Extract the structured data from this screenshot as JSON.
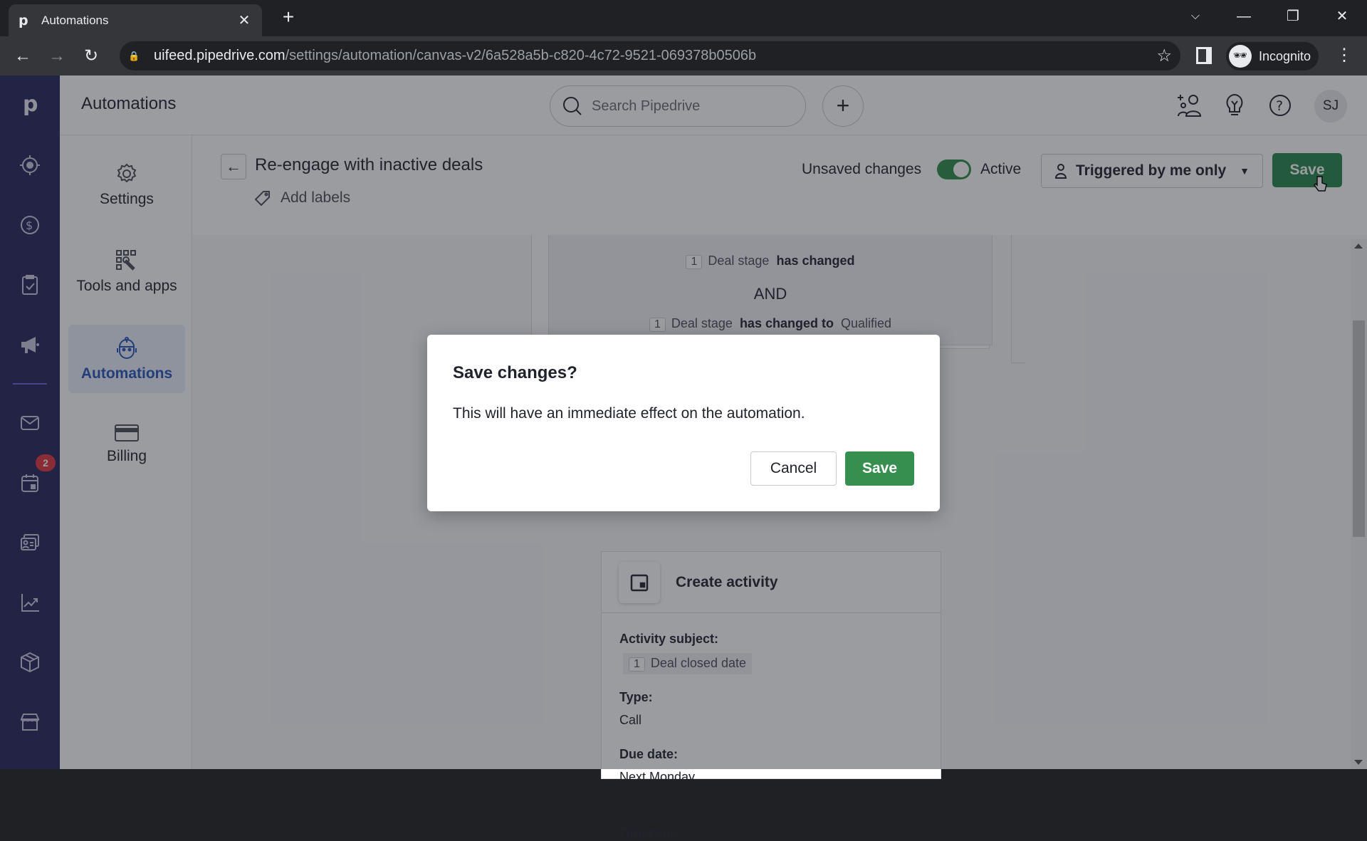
{
  "browser": {
    "tab_title": "Automations",
    "tab_favicon": "p",
    "url_host": "uifeed.pipedrive.com",
    "url_path": "/settings/automation/canvas-v2/6a528a5b-c820-4c72-9521-069378b0506b",
    "profile_label": "Incognito"
  },
  "app": {
    "title": "Automations",
    "search_placeholder": "Search Pipedrive",
    "avatar_initials": "SJ",
    "left_nav": {
      "icons": [
        "leads-target-icon",
        "deals-dollar-icon",
        "activities-clipboard-icon",
        "campaigns-megaphone-icon",
        "mail-icon",
        "calendar-icon",
        "contacts-card-icon",
        "insights-chart-icon",
        "products-box-icon",
        "marketplace-store-icon"
      ],
      "calendar_badge": "2"
    },
    "settings_nav": [
      {
        "label": "Settings",
        "icon": "gear-icon",
        "active": false
      },
      {
        "label": "Tools and apps",
        "icon": "tools-apps-icon",
        "active": false
      },
      {
        "label": "Automations",
        "icon": "robot-icon",
        "active": true
      },
      {
        "label": "Billing",
        "icon": "credit-card-icon",
        "active": false
      }
    ]
  },
  "editor": {
    "automation_name": "Re-engage with inactive deals",
    "add_labels": "Add labels",
    "unsaved_changes": "Unsaved changes",
    "active_label": "Active",
    "active": true,
    "trigger_scope": "Triggered by me only",
    "save_label": "Save",
    "trigger_card": {
      "cond1": {
        "chip": "1",
        "field": "Deal stage",
        "op": "has changed",
        "value": ""
      },
      "joiner": "AND",
      "cond2": {
        "chip": "1",
        "field": "Deal stage",
        "op": "has changed to",
        "value": "Qualified"
      }
    },
    "action_card": {
      "title": "Create activity",
      "fields": [
        {
          "label": "Activity subject:",
          "chip": "1",
          "value": "Deal closed date"
        },
        {
          "label": "Type:",
          "value": "Call"
        },
        {
          "label": "Due date:",
          "value": "Next Monday"
        },
        {
          "label": "Timezone:",
          "value": ""
        }
      ]
    }
  },
  "dialog": {
    "title": "Save changes?",
    "body": "This will have an immediate effect on the automation.",
    "cancel_label": "Cancel",
    "save_label": "Save"
  },
  "colors": {
    "nav_bg": "#26235c",
    "save_green": "#26874b",
    "active_blue": "#2654b8",
    "badge_red": "#e0343e"
  }
}
